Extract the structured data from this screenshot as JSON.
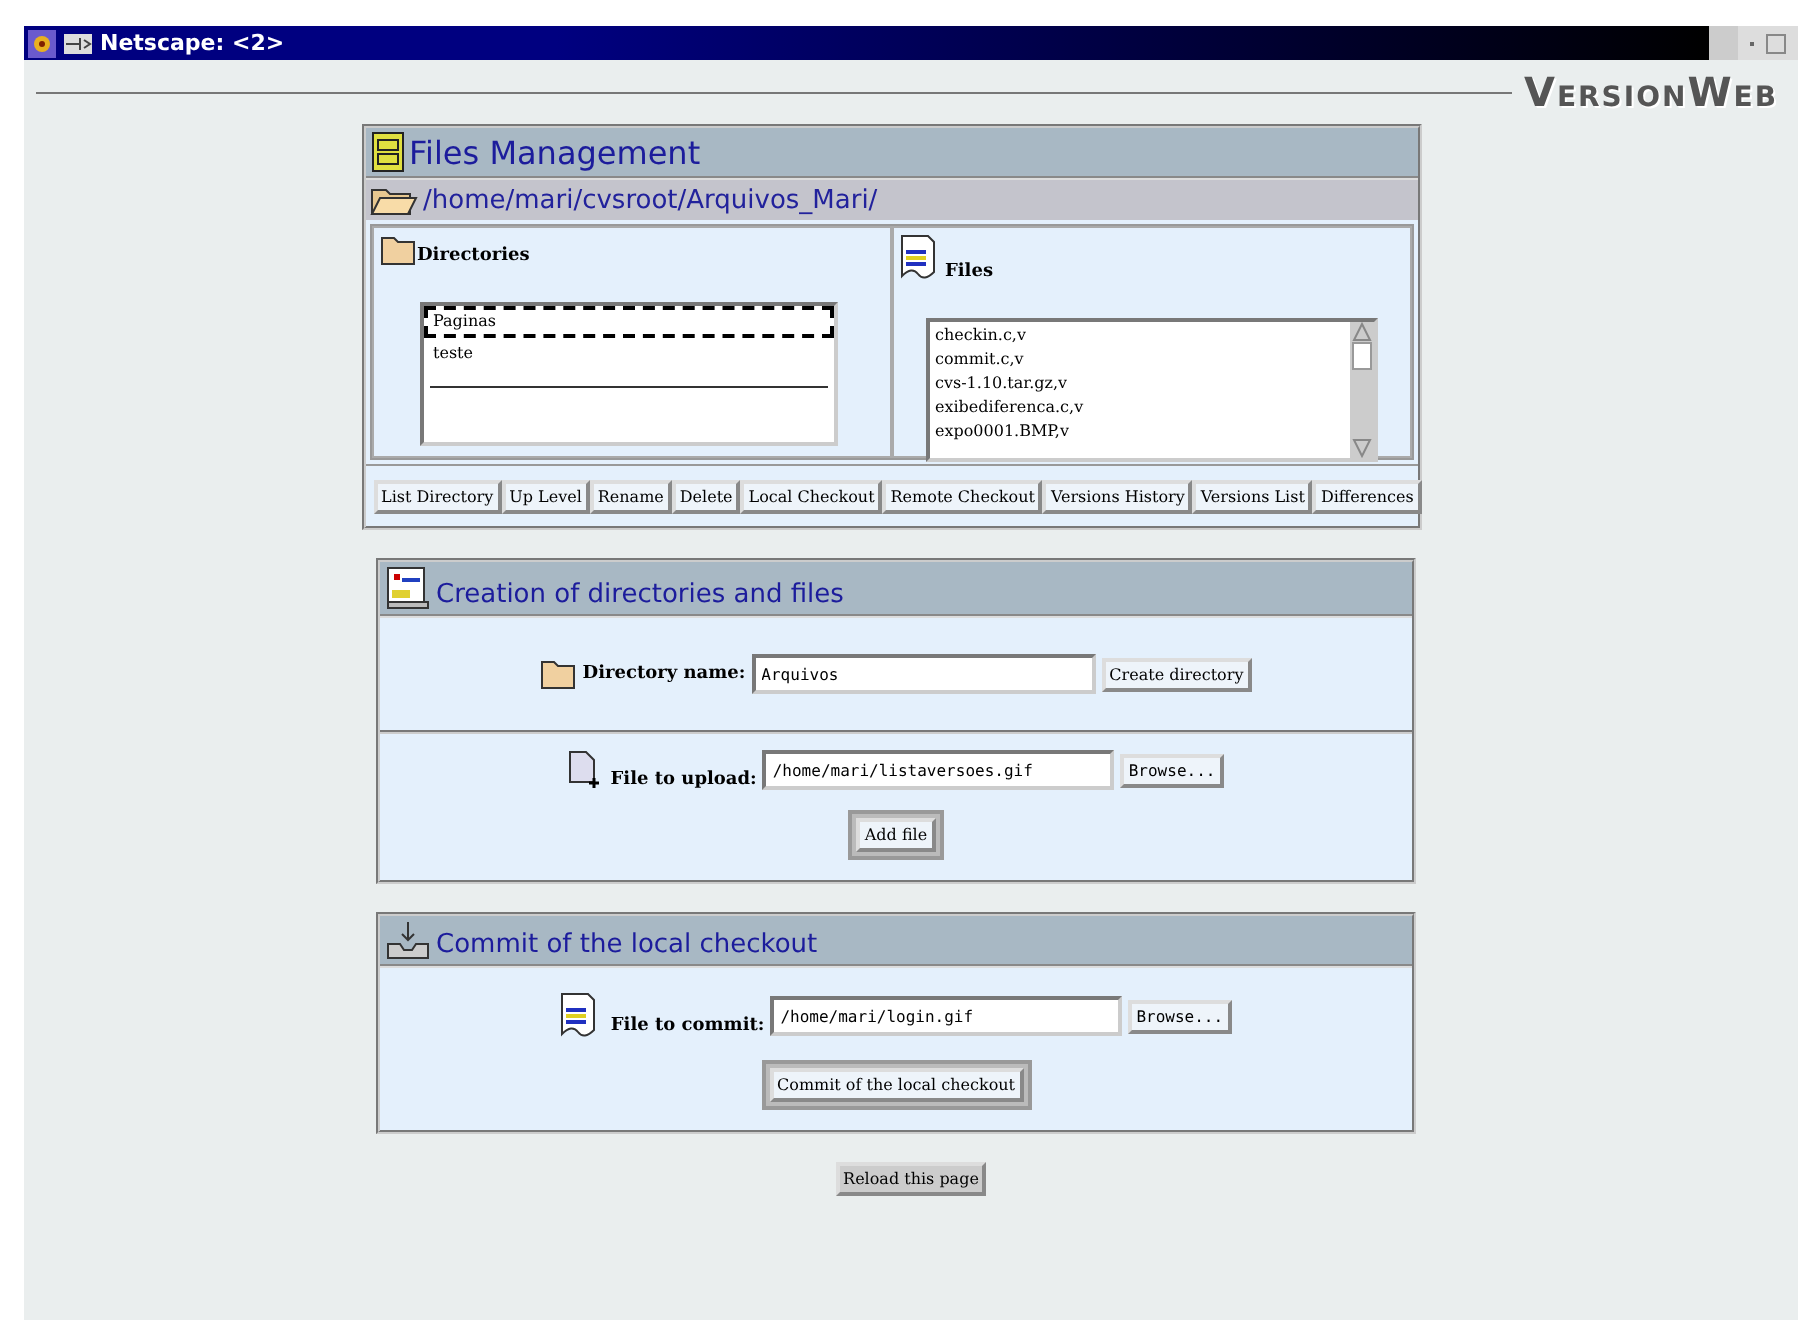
{
  "window": {
    "title": "Netscape:  <2>"
  },
  "logo": "VersionWeb",
  "files_management": {
    "title": "Files Management",
    "path": "/home/mari/cvsroot/Arquivos_Mari/",
    "directories": {
      "label": "Directories",
      "items": [
        {
          "name": "Paginas",
          "selected": true
        },
        {
          "name": "teste",
          "selected": false
        }
      ]
    },
    "files": {
      "label": "Files",
      "items": [
        {
          "name": "checkin.c,v",
          "selected": false
        },
        {
          "name": "commit.c,v",
          "selected": false
        },
        {
          "name": "cvs-1.10.tar.gz,v",
          "selected": false
        },
        {
          "name": "exibediferenca.c,v",
          "selected": false
        },
        {
          "name": "expo0001.BMP,v",
          "selected": false
        }
      ]
    },
    "buttons": [
      "List Directory",
      "Up Level",
      "Rename",
      "Delete",
      "Local Checkout",
      "Remote Checkout",
      "Versions History",
      "Versions List",
      "Differences"
    ]
  },
  "creation": {
    "title": "Creation of directories and files",
    "directory_label": "Directory name:",
    "directory_value": "Arquivos",
    "create_button": "Create directory",
    "upload_label": "File to upload:",
    "upload_value": "/home/mari/listaversoes.gif",
    "browse_button": "Browse...",
    "add_button": "Add file"
  },
  "commit": {
    "title": "Commit of the local checkout",
    "file_label": "File to commit:",
    "file_value": "/home/mari/login.gif",
    "browse_button": "Browse...",
    "commit_button": "Commit of the local checkout"
  },
  "reload_button": "Reload this page"
}
